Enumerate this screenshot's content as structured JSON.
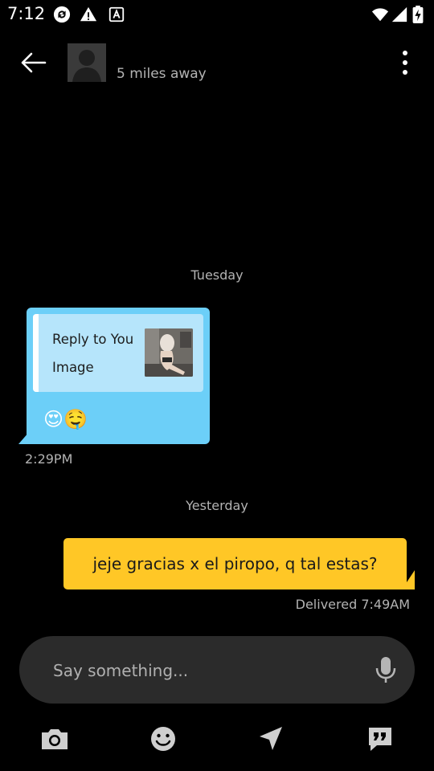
{
  "status_bar": {
    "time": "7:12",
    "icons": [
      "sync-icon",
      "warning-icon",
      "font-a-icon",
      "wifi-icon",
      "signal-icon",
      "battery-charging-icon"
    ]
  },
  "header": {
    "distance": "5 miles away"
  },
  "messages": {
    "day_tuesday": "Tuesday",
    "day_yesterday": "Yesterday",
    "received": {
      "reply_title": "Reply to You",
      "reply_type": "Image",
      "emoji": "😍🤤",
      "time": "2:29PM"
    },
    "sent": {
      "text": "jeje gracias x el piropo, q tal estas?",
      "status": "Delivered 7:49AM"
    }
  },
  "composer": {
    "placeholder": "Say something..."
  },
  "toolbar": {
    "icons": [
      "camera-icon",
      "emoji-icon",
      "location-send-icon",
      "quick-reply-icon"
    ]
  },
  "colors": {
    "background": "#000000",
    "received_bubble": "#6ccff8",
    "reply_card": "#b6e5fb",
    "sent_bubble": "#ffc726",
    "input_bg": "#2b2b2b",
    "muted_text": "#b3b3b3"
  }
}
